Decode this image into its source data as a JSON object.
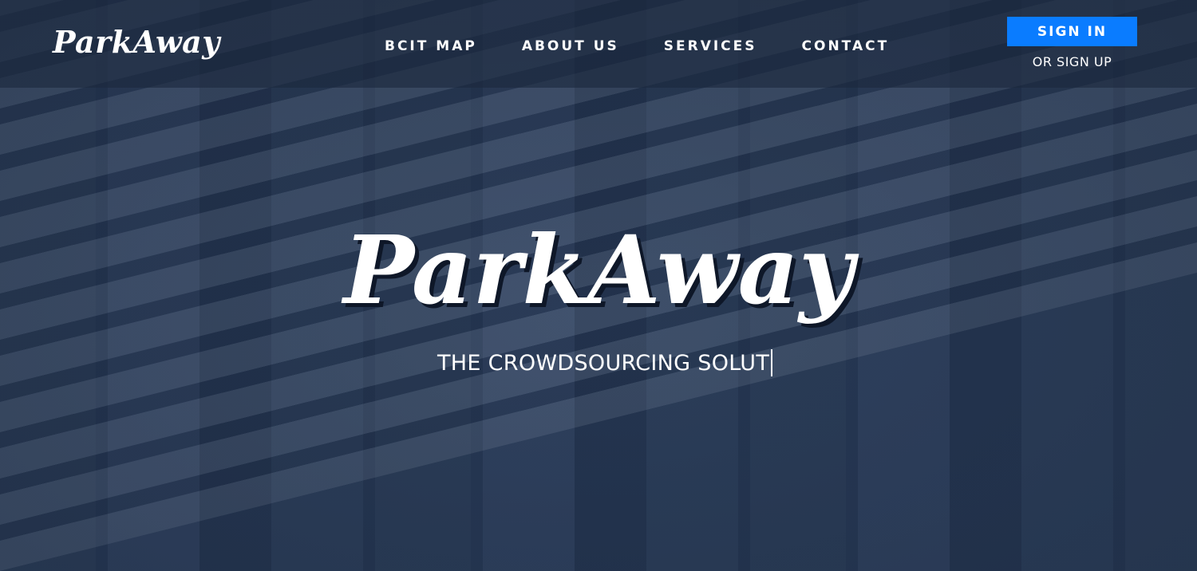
{
  "brand": {
    "logo_text": "ParkAway"
  },
  "nav": {
    "links": [
      {
        "label": "BCIT MAP"
      },
      {
        "label": "ABOUT US"
      },
      {
        "label": "SERVICES"
      },
      {
        "label": "CONTACT"
      }
    ]
  },
  "auth": {
    "sign_in_label": "SIGN IN",
    "sign_up_label": "OR SIGN UP"
  },
  "hero": {
    "title": "ParkAway",
    "tagline": "THE CROWDSOURCING SOLUT"
  },
  "colors": {
    "accent": "#0a7cff",
    "navbar": "#1c283e",
    "text": "#ffffff"
  }
}
